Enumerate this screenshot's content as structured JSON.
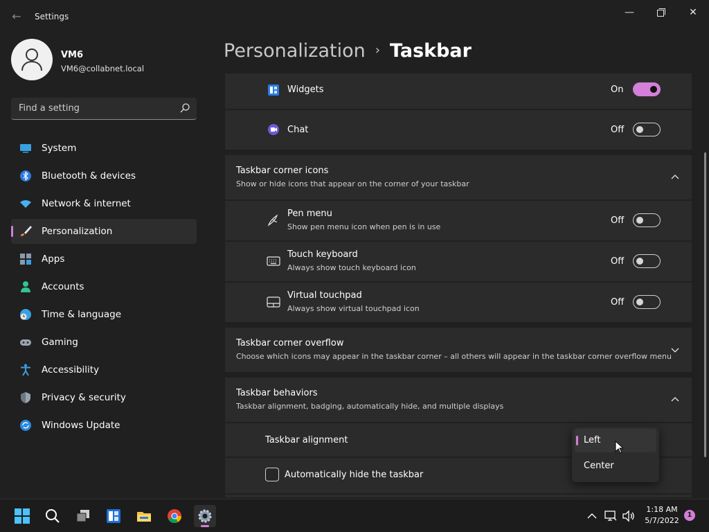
{
  "window": {
    "title": "Settings",
    "back_icon": "back-arrow-icon",
    "controls": [
      "minimize-icon",
      "maximize-icon",
      "close-icon"
    ]
  },
  "profile": {
    "name": "VM6",
    "email": "VM6@collabnet.local"
  },
  "search": {
    "placeholder": "Find a setting",
    "icon": "search-icon"
  },
  "sidebar": {
    "items": [
      {
        "label": "System",
        "icon": "system-icon",
        "active": false
      },
      {
        "label": "Bluetooth & devices",
        "icon": "bluetooth-icon",
        "active": false
      },
      {
        "label": "Network & internet",
        "icon": "wifi-icon",
        "active": false
      },
      {
        "label": "Personalization",
        "icon": "brush-icon",
        "active": true
      },
      {
        "label": "Apps",
        "icon": "apps-icon",
        "active": false
      },
      {
        "label": "Accounts",
        "icon": "accounts-icon",
        "active": false
      },
      {
        "label": "Time & language",
        "icon": "clock-globe-icon",
        "active": false
      },
      {
        "label": "Gaming",
        "icon": "gamepad-icon",
        "active": false
      },
      {
        "label": "Accessibility",
        "icon": "accessibility-icon",
        "active": false
      },
      {
        "label": "Privacy & security",
        "icon": "shield-icon",
        "active": false
      },
      {
        "label": "Windows Update",
        "icon": "update-icon",
        "active": false
      }
    ],
    "accent": "#d27fd6"
  },
  "breadcrumb": {
    "parent": "Personalization",
    "separator": "›",
    "current": "Taskbar"
  },
  "main": {
    "widgets": {
      "label": "Widgets",
      "state": "On",
      "on": true
    },
    "chat": {
      "label": "Chat",
      "state": "Off",
      "on": false
    },
    "corner_icons": {
      "title": "Taskbar corner icons",
      "desc": "Show or hide icons that appear on the corner of your taskbar",
      "expanded": true,
      "items": [
        {
          "title": "Pen menu",
          "desc": "Show pen menu icon when pen is in use",
          "state": "Off",
          "on": false
        },
        {
          "title": "Touch keyboard",
          "desc": "Always show touch keyboard icon",
          "state": "Off",
          "on": false
        },
        {
          "title": "Virtual touchpad",
          "desc": "Always show virtual touchpad icon",
          "state": "Off",
          "on": false
        }
      ]
    },
    "corner_overflow": {
      "title": "Taskbar corner overflow",
      "desc": "Choose which icons may appear in the taskbar corner – all others will appear in the taskbar corner overflow menu",
      "expanded": false
    },
    "behaviors": {
      "title": "Taskbar behaviors",
      "desc": "Taskbar alignment, badging, automatically hide, and multiple displays",
      "expanded": true,
      "alignment_label": "Taskbar alignment",
      "alignment_options": [
        "Left",
        "Center"
      ],
      "alignment_selected": "Left",
      "autohide_label": "Automatically hide the taskbar",
      "autohide_checked": false
    }
  },
  "taskbar": {
    "apps": [
      "start-icon",
      "search-icon",
      "task-view-icon",
      "widgets-icon",
      "file-explorer-icon",
      "chrome-icon",
      "settings-icon"
    ],
    "tray": [
      "chevron-up-icon",
      "network-icon",
      "volume-icon"
    ],
    "time": "1:18 AM",
    "date": "5/7/2022",
    "notification_count": "1"
  },
  "colors": {
    "background": "#202020",
    "card": "#2b2b2b",
    "accent": "#d27fd6"
  }
}
